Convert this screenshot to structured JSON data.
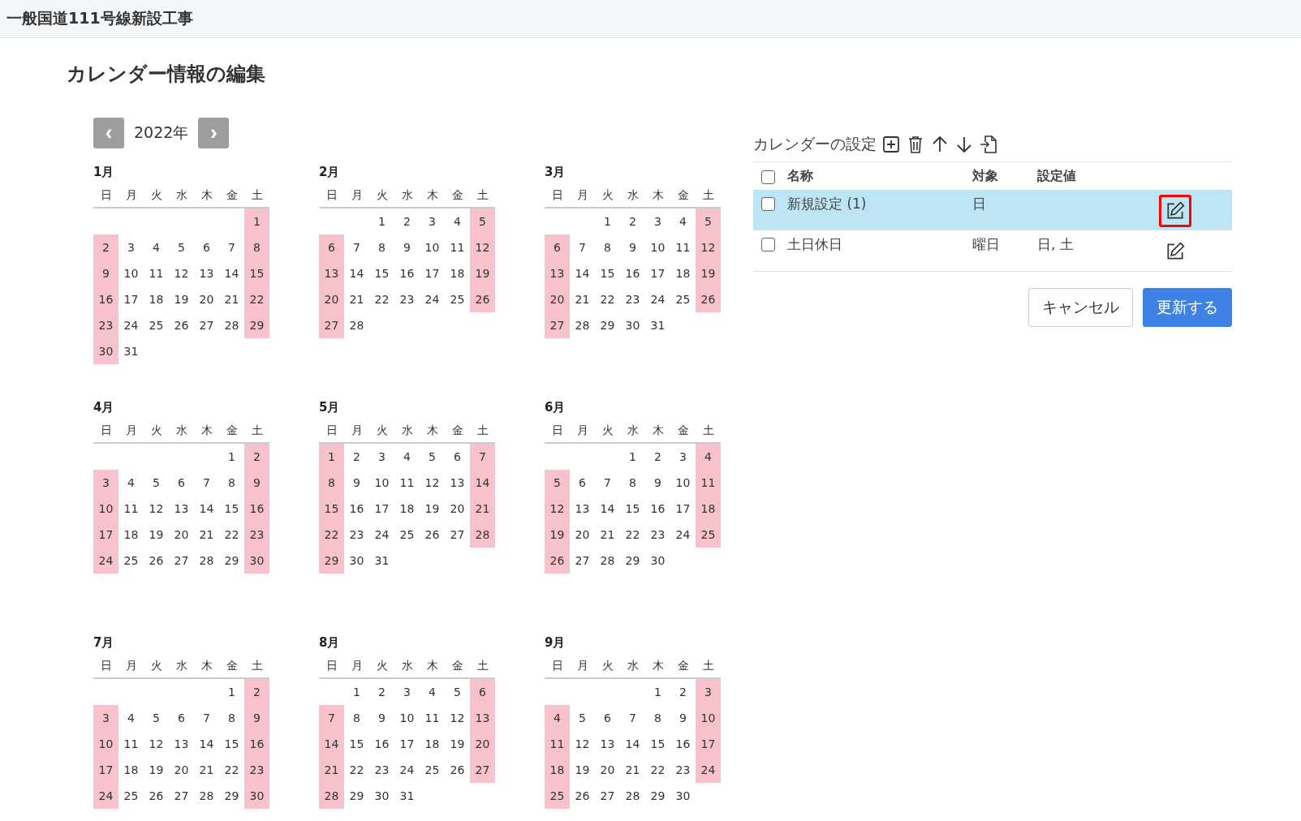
{
  "header": {
    "title": "一般国道111号線新設工事"
  },
  "page_title": "カレンダー情報の編集",
  "year_nav": {
    "prev": "‹",
    "year": "2022年",
    "next": "›"
  },
  "months": [
    {
      "name": "1月",
      "weekdays": [
        "日",
        "月",
        "火",
        "水",
        "木",
        "金",
        "土"
      ],
      "weeks": [
        {
          "kind": "lead",
          "days": [
            {
              "day": "1",
              "holiday": true
            }
          ]
        },
        {
          "kind": "full",
          "days": [
            {
              "day": "2",
              "holiday": true
            },
            {
              "day": "3",
              "holiday": false
            },
            {
              "day": "4",
              "holiday": false
            },
            {
              "day": "5",
              "holiday": false
            },
            {
              "day": "6",
              "holiday": false
            },
            {
              "day": "7",
              "holiday": false
            },
            {
              "day": "8",
              "holiday": true
            }
          ]
        },
        {
          "kind": "full",
          "days": [
            {
              "day": "9",
              "holiday": true
            },
            {
              "day": "10",
              "holiday": false
            },
            {
              "day": "11",
              "holiday": false
            },
            {
              "day": "12",
              "holiday": false
            },
            {
              "day": "13",
              "holiday": false
            },
            {
              "day": "14",
              "holiday": false
            },
            {
              "day": "15",
              "holiday": true
            }
          ]
        },
        {
          "kind": "full",
          "days": [
            {
              "day": "16",
              "holiday": true
            },
            {
              "day": "17",
              "holiday": false
            },
            {
              "day": "18",
              "holiday": false
            },
            {
              "day": "19",
              "holiday": false
            },
            {
              "day": "20",
              "holiday": false
            },
            {
              "day": "21",
              "holiday": false
            },
            {
              "day": "22",
              "holiday": true
            }
          ]
        },
        {
          "kind": "full",
          "days": [
            {
              "day": "23",
              "holiday": true
            },
            {
              "day": "24",
              "holiday": false
            },
            {
              "day": "25",
              "holiday": false
            },
            {
              "day": "26",
              "holiday": false
            },
            {
              "day": "27",
              "holiday": false
            },
            {
              "day": "28",
              "holiday": false
            },
            {
              "day": "29",
              "holiday": true
            }
          ]
        },
        {
          "kind": "tail",
          "days": [
            {
              "day": "30",
              "holiday": true
            },
            {
              "day": "31",
              "holiday": false
            }
          ]
        }
      ]
    },
    {
      "name": "2月",
      "weekdays": [
        "日",
        "月",
        "火",
        "水",
        "木",
        "金",
        "土"
      ],
      "weeks": [
        {
          "kind": "lead",
          "days": [
            {
              "day": "1",
              "holiday": false
            },
            {
              "day": "2",
              "holiday": false
            },
            {
              "day": "3",
              "holiday": false
            },
            {
              "day": "4",
              "holiday": false
            },
            {
              "day": "5",
              "holiday": true
            }
          ]
        },
        {
          "kind": "full",
          "days": [
            {
              "day": "6",
              "holiday": true
            },
            {
              "day": "7",
              "holiday": false
            },
            {
              "day": "8",
              "holiday": false
            },
            {
              "day": "9",
              "holiday": false
            },
            {
              "day": "10",
              "holiday": false
            },
            {
              "day": "11",
              "holiday": false
            },
            {
              "day": "12",
              "holiday": true
            }
          ]
        },
        {
          "kind": "full",
          "days": [
            {
              "day": "13",
              "holiday": true
            },
            {
              "day": "14",
              "holiday": false
            },
            {
              "day": "15",
              "holiday": false
            },
            {
              "day": "16",
              "holiday": false
            },
            {
              "day": "17",
              "holiday": false
            },
            {
              "day": "18",
              "holiday": false
            },
            {
              "day": "19",
              "holiday": true
            }
          ]
        },
        {
          "kind": "full",
          "days": [
            {
              "day": "20",
              "holiday": true
            },
            {
              "day": "21",
              "holiday": false
            },
            {
              "day": "22",
              "holiday": false
            },
            {
              "day": "23",
              "holiday": false
            },
            {
              "day": "24",
              "holiday": false
            },
            {
              "day": "25",
              "holiday": false
            },
            {
              "day": "26",
              "holiday": true
            }
          ]
        },
        {
          "kind": "tail",
          "days": [
            {
              "day": "27",
              "holiday": true
            },
            {
              "day": "28",
              "holiday": false
            }
          ]
        }
      ]
    },
    {
      "name": "3月",
      "weekdays": [
        "日",
        "月",
        "火",
        "水",
        "木",
        "金",
        "土"
      ],
      "weeks": [
        {
          "kind": "lead",
          "days": [
            {
              "day": "1",
              "holiday": false
            },
            {
              "day": "2",
              "holiday": false
            },
            {
              "day": "3",
              "holiday": false
            },
            {
              "day": "4",
              "holiday": false
            },
            {
              "day": "5",
              "holiday": true
            }
          ]
        },
        {
          "kind": "full",
          "days": [
            {
              "day": "6",
              "holiday": true
            },
            {
              "day": "7",
              "holiday": false
            },
            {
              "day": "8",
              "holiday": false
            },
            {
              "day": "9",
              "holiday": false
            },
            {
              "day": "10",
              "holiday": false
            },
            {
              "day": "11",
              "holiday": false
            },
            {
              "day": "12",
              "holiday": true
            }
          ]
        },
        {
          "kind": "full",
          "days": [
            {
              "day": "13",
              "holiday": true
            },
            {
              "day": "14",
              "holiday": false
            },
            {
              "day": "15",
              "holiday": false
            },
            {
              "day": "16",
              "holiday": false
            },
            {
              "day": "17",
              "holiday": false
            },
            {
              "day": "18",
              "holiday": false
            },
            {
              "day": "19",
              "holiday": true
            }
          ]
        },
        {
          "kind": "full",
          "days": [
            {
              "day": "20",
              "holiday": true
            },
            {
              "day": "21",
              "holiday": false
            },
            {
              "day": "22",
              "holiday": false
            },
            {
              "day": "23",
              "holiday": false
            },
            {
              "day": "24",
              "holiday": false
            },
            {
              "day": "25",
              "holiday": false
            },
            {
              "day": "26",
              "holiday": true
            }
          ]
        },
        {
          "kind": "tail",
          "days": [
            {
              "day": "27",
              "holiday": true
            },
            {
              "day": "28",
              "holiday": false
            },
            {
              "day": "29",
              "holiday": false
            },
            {
              "day": "30",
              "holiday": false
            },
            {
              "day": "31",
              "holiday": false
            }
          ]
        }
      ]
    },
    {
      "name": "4月",
      "weekdays": [
        "日",
        "月",
        "火",
        "水",
        "木",
        "金",
        "土"
      ],
      "weeks": [
        {
          "kind": "lead",
          "days": [
            {
              "day": "1",
              "holiday": false
            },
            {
              "day": "2",
              "holiday": true
            }
          ]
        },
        {
          "kind": "full",
          "days": [
            {
              "day": "3",
              "holiday": true
            },
            {
              "day": "4",
              "holiday": false
            },
            {
              "day": "5",
              "holiday": false
            },
            {
              "day": "6",
              "holiday": false
            },
            {
              "day": "7",
              "holiday": false
            },
            {
              "day": "8",
              "holiday": false
            },
            {
              "day": "9",
              "holiday": true
            }
          ]
        },
        {
          "kind": "full",
          "days": [
            {
              "day": "10",
              "holiday": true
            },
            {
              "day": "11",
              "holiday": false
            },
            {
              "day": "12",
              "holiday": false
            },
            {
              "day": "13",
              "holiday": false
            },
            {
              "day": "14",
              "holiday": false
            },
            {
              "day": "15",
              "holiday": false
            },
            {
              "day": "16",
              "holiday": true
            }
          ]
        },
        {
          "kind": "full",
          "days": [
            {
              "day": "17",
              "holiday": true
            },
            {
              "day": "18",
              "holiday": false
            },
            {
              "day": "19",
              "holiday": false
            },
            {
              "day": "20",
              "holiday": false
            },
            {
              "day": "21",
              "holiday": false
            },
            {
              "day": "22",
              "holiday": false
            },
            {
              "day": "23",
              "holiday": true
            }
          ]
        },
        {
          "kind": "full",
          "days": [
            {
              "day": "24",
              "holiday": true
            },
            {
              "day": "25",
              "holiday": false
            },
            {
              "day": "26",
              "holiday": false
            },
            {
              "day": "27",
              "holiday": false
            },
            {
              "day": "28",
              "holiday": false
            },
            {
              "day": "29",
              "holiday": false
            },
            {
              "day": "30",
              "holiday": true
            }
          ]
        }
      ]
    },
    {
      "name": "5月",
      "weekdays": [
        "日",
        "月",
        "火",
        "水",
        "木",
        "金",
        "土"
      ],
      "weeks": [
        {
          "kind": "full",
          "days": [
            {
              "day": "1",
              "holiday": true
            },
            {
              "day": "2",
              "holiday": false
            },
            {
              "day": "3",
              "holiday": false
            },
            {
              "day": "4",
              "holiday": false
            },
            {
              "day": "5",
              "holiday": false
            },
            {
              "day": "6",
              "holiday": false
            },
            {
              "day": "7",
              "holiday": true
            }
          ]
        },
        {
          "kind": "full",
          "days": [
            {
              "day": "8",
              "holiday": true
            },
            {
              "day": "9",
              "holiday": false
            },
            {
              "day": "10",
              "holiday": false
            },
            {
              "day": "11",
              "holiday": false
            },
            {
              "day": "12",
              "holiday": false
            },
            {
              "day": "13",
              "holiday": false
            },
            {
              "day": "14",
              "holiday": true
            }
          ]
        },
        {
          "kind": "full",
          "days": [
            {
              "day": "15",
              "holiday": true
            },
            {
              "day": "16",
              "holiday": false
            },
            {
              "day": "17",
              "holiday": false
            },
            {
              "day": "18",
              "holiday": false
            },
            {
              "day": "19",
              "holiday": false
            },
            {
              "day": "20",
              "holiday": false
            },
            {
              "day": "21",
              "holiday": true
            }
          ]
        },
        {
          "kind": "full",
          "days": [
            {
              "day": "22",
              "holiday": true
            },
            {
              "day": "23",
              "holiday": false
            },
            {
              "day": "24",
              "holiday": false
            },
            {
              "day": "25",
              "holiday": false
            },
            {
              "day": "26",
              "holiday": false
            },
            {
              "day": "27",
              "holiday": false
            },
            {
              "day": "28",
              "holiday": true
            }
          ]
        },
        {
          "kind": "tail",
          "days": [
            {
              "day": "29",
              "holiday": true
            },
            {
              "day": "30",
              "holiday": false
            },
            {
              "day": "31",
              "holiday": false
            }
          ]
        }
      ]
    },
    {
      "name": "6月",
      "weekdays": [
        "日",
        "月",
        "火",
        "水",
        "木",
        "金",
        "土"
      ],
      "weeks": [
        {
          "kind": "lead",
          "days": [
            {
              "day": "1",
              "holiday": false
            },
            {
              "day": "2",
              "holiday": false
            },
            {
              "day": "3",
              "holiday": false
            },
            {
              "day": "4",
              "holiday": true
            }
          ]
        },
        {
          "kind": "full",
          "days": [
            {
              "day": "5",
              "holiday": true
            },
            {
              "day": "6",
              "holiday": false
            },
            {
              "day": "7",
              "holiday": false
            },
            {
              "day": "8",
              "holiday": false
            },
            {
              "day": "9",
              "holiday": false
            },
            {
              "day": "10",
              "holiday": false
            },
            {
              "day": "11",
              "holiday": true
            }
          ]
        },
        {
          "kind": "full",
          "days": [
            {
              "day": "12",
              "holiday": true
            },
            {
              "day": "13",
              "holiday": false
            },
            {
              "day": "14",
              "holiday": false
            },
            {
              "day": "15",
              "holiday": false
            },
            {
              "day": "16",
              "holiday": false
            },
            {
              "day": "17",
              "holiday": false
            },
            {
              "day": "18",
              "holiday": true
            }
          ]
        },
        {
          "kind": "full",
          "days": [
            {
              "day": "19",
              "holiday": true
            },
            {
              "day": "20",
              "holiday": false
            },
            {
              "day": "21",
              "holiday": false
            },
            {
              "day": "22",
              "holiday": false
            },
            {
              "day": "23",
              "holiday": false
            },
            {
              "day": "24",
              "holiday": false
            },
            {
              "day": "25",
              "holiday": true
            }
          ]
        },
        {
          "kind": "tail",
          "days": [
            {
              "day": "26",
              "holiday": true
            },
            {
              "day": "27",
              "holiday": false
            },
            {
              "day": "28",
              "holiday": false
            },
            {
              "day": "29",
              "holiday": false
            },
            {
              "day": "30",
              "holiday": false
            }
          ]
        }
      ]
    },
    {
      "name": "7月",
      "weekdays": [
        "日",
        "月",
        "火",
        "水",
        "木",
        "金",
        "土"
      ],
      "weeks": [
        {
          "kind": "lead",
          "days": [
            {
              "day": "1",
              "holiday": false
            },
            {
              "day": "2",
              "holiday": true
            }
          ]
        },
        {
          "kind": "full",
          "days": [
            {
              "day": "3",
              "holiday": true
            },
            {
              "day": "4",
              "holiday": false
            },
            {
              "day": "5",
              "holiday": false
            },
            {
              "day": "6",
              "holiday": false
            },
            {
              "day": "7",
              "holiday": false
            },
            {
              "day": "8",
              "holiday": false
            },
            {
              "day": "9",
              "holiday": true
            }
          ]
        },
        {
          "kind": "full",
          "days": [
            {
              "day": "10",
              "holiday": true
            },
            {
              "day": "11",
              "holiday": false
            },
            {
              "day": "12",
              "holiday": false
            },
            {
              "day": "13",
              "holiday": false
            },
            {
              "day": "14",
              "holiday": false
            },
            {
              "day": "15",
              "holiday": false
            },
            {
              "day": "16",
              "holiday": true
            }
          ]
        },
        {
          "kind": "full",
          "days": [
            {
              "day": "17",
              "holiday": true
            },
            {
              "day": "18",
              "holiday": false
            },
            {
              "day": "19",
              "holiday": false
            },
            {
              "day": "20",
              "holiday": false
            },
            {
              "day": "21",
              "holiday": false
            },
            {
              "day": "22",
              "holiday": false
            },
            {
              "day": "23",
              "holiday": true
            }
          ]
        },
        {
          "kind": "full",
          "days": [
            {
              "day": "24",
              "holiday": true
            },
            {
              "day": "25",
              "holiday": false
            },
            {
              "day": "26",
              "holiday": false
            },
            {
              "day": "27",
              "holiday": false
            },
            {
              "day": "28",
              "holiday": false
            },
            {
              "day": "29",
              "holiday": false
            },
            {
              "day": "30",
              "holiday": true
            }
          ]
        }
      ]
    },
    {
      "name": "8月",
      "weekdays": [
        "日",
        "月",
        "火",
        "水",
        "木",
        "金",
        "土"
      ],
      "weeks": [
        {
          "kind": "lead",
          "days": [
            {
              "day": "1",
              "holiday": false
            },
            {
              "day": "2",
              "holiday": false
            },
            {
              "day": "3",
              "holiday": false
            },
            {
              "day": "4",
              "holiday": false
            },
            {
              "day": "5",
              "holiday": false
            },
            {
              "day": "6",
              "holiday": true
            }
          ]
        },
        {
          "kind": "full",
          "days": [
            {
              "day": "7",
              "holiday": true
            },
            {
              "day": "8",
              "holiday": false
            },
            {
              "day": "9",
              "holiday": false
            },
            {
              "day": "10",
              "holiday": false
            },
            {
              "day": "11",
              "holiday": false
            },
            {
              "day": "12",
              "holiday": false
            },
            {
              "day": "13",
              "holiday": true
            }
          ]
        },
        {
          "kind": "full",
          "days": [
            {
              "day": "14",
              "holiday": true
            },
            {
              "day": "15",
              "holiday": false
            },
            {
              "day": "16",
              "holiday": false
            },
            {
              "day": "17",
              "holiday": false
            },
            {
              "day": "18",
              "holiday": false
            },
            {
              "day": "19",
              "holiday": false
            },
            {
              "day": "20",
              "holiday": true
            }
          ]
        },
        {
          "kind": "full",
          "days": [
            {
              "day": "21",
              "holiday": true
            },
            {
              "day": "22",
              "holiday": false
            },
            {
              "day": "23",
              "holiday": false
            },
            {
              "day": "24",
              "holiday": false
            },
            {
              "day": "25",
              "holiday": false
            },
            {
              "day": "26",
              "holiday": false
            },
            {
              "day": "27",
              "holiday": true
            }
          ]
        },
        {
          "kind": "tail",
          "days": [
            {
              "day": "28",
              "holiday": true
            },
            {
              "day": "29",
              "holiday": false
            },
            {
              "day": "30",
              "holiday": false
            },
            {
              "day": "31",
              "holiday": false
            }
          ]
        }
      ]
    },
    {
      "name": "9月",
      "weekdays": [
        "日",
        "月",
        "火",
        "水",
        "木",
        "金",
        "土"
      ],
      "weeks": [
        {
          "kind": "lead",
          "days": [
            {
              "day": "1",
              "holiday": false
            },
            {
              "day": "2",
              "holiday": false
            },
            {
              "day": "3",
              "holiday": true
            }
          ]
        },
        {
          "kind": "full",
          "days": [
            {
              "day": "4",
              "holiday": true
            },
            {
              "day": "5",
              "holiday": false
            },
            {
              "day": "6",
              "holiday": false
            },
            {
              "day": "7",
              "holiday": false
            },
            {
              "day": "8",
              "holiday": false
            },
            {
              "day": "9",
              "holiday": false
            },
            {
              "day": "10",
              "holiday": true
            }
          ]
        },
        {
          "kind": "full",
          "days": [
            {
              "day": "11",
              "holiday": true
            },
            {
              "day": "12",
              "holiday": false
            },
            {
              "day": "13",
              "holiday": false
            },
            {
              "day": "14",
              "holiday": false
            },
            {
              "day": "15",
              "holiday": false
            },
            {
              "day": "16",
              "holiday": false
            },
            {
              "day": "17",
              "holiday": true
            }
          ]
        },
        {
          "kind": "full",
          "days": [
            {
              "day": "18",
              "holiday": true
            },
            {
              "day": "19",
              "holiday": false
            },
            {
              "day": "20",
              "holiday": false
            },
            {
              "day": "21",
              "holiday": false
            },
            {
              "day": "22",
              "holiday": false
            },
            {
              "day": "23",
              "holiday": false
            },
            {
              "day": "24",
              "holiday": true
            }
          ]
        },
        {
          "kind": "tail",
          "days": [
            {
              "day": "25",
              "holiday": true
            },
            {
              "day": "26",
              "holiday": false
            },
            {
              "day": "27",
              "holiday": false
            },
            {
              "day": "28",
              "holiday": false
            },
            {
              "day": "29",
              "holiday": false
            },
            {
              "day": "30",
              "holiday": false
            }
          ]
        }
      ]
    }
  ],
  "settings": {
    "title": "カレンダーの設定",
    "table": {
      "select_all": {
        "checked": false
      },
      "columns": [
        "名称",
        "対象",
        "設定値"
      ],
      "rows": [
        {
          "name": "新規設定 (1)",
          "target": "日",
          "checked": false,
          "selected": true,
          "highlighted": true
        },
        {
          "name": "土日休日",
          "target": "曜日",
          "value": "日, 土",
          "checked": false,
          "selected": false,
          "highlighted": false
        }
      ]
    },
    "buttons": [
      {
        "label": "キャンセル",
        "kind": "secondary"
      },
      {
        "label": "更新する",
        "kind": "primary"
      }
    ]
  }
}
